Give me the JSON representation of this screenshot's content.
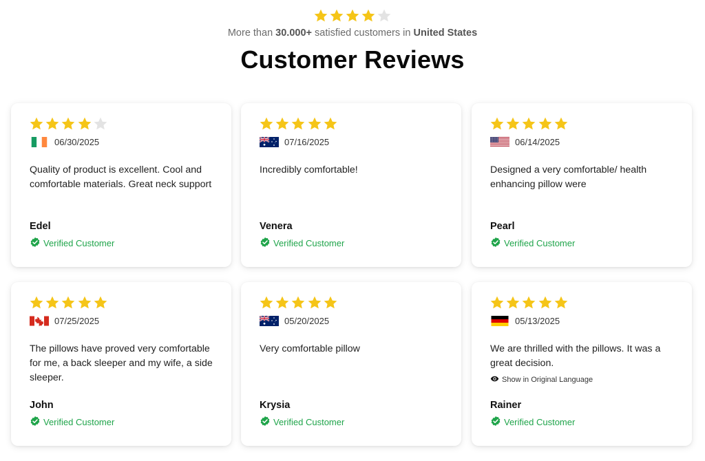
{
  "header": {
    "rating_stars": 4,
    "tagline_prefix": "More than ",
    "tagline_count": "30.000+",
    "tagline_middle": " satisfied customers in ",
    "tagline_country": "United States",
    "title": "Customer Reviews"
  },
  "colors": {
    "star_filled": "#F5C518",
    "star_empty": "#E3E3E3",
    "verified": "#1FA44A"
  },
  "reviews": [
    {
      "stars": 4,
      "flag": "ireland-flag",
      "date": "06/30/2025",
      "text": "Quality of product is excellent. Cool and comfortable materials. Great neck support",
      "name": "Edel",
      "verified": "Verified Customer"
    },
    {
      "stars": 5,
      "flag": "australia-flag",
      "date": "07/16/2025",
      "text": "Incredibly comfortable!",
      "name": "Venera",
      "verified": "Verified Customer"
    },
    {
      "stars": 5,
      "flag": "usa-flag",
      "date": "06/14/2025",
      "text": "Designed a very comfortable/ health enhancing pillow were",
      "name": "Pearl",
      "verified": "Verified Customer"
    },
    {
      "stars": 5,
      "flag": "canada-flag",
      "date": "07/25/2025",
      "text": "The pillows have proved very comfortable for me, a back sleeper and my wife, a side sleeper.",
      "name": "John",
      "verified": "Verified Customer"
    },
    {
      "stars": 5,
      "flag": "australia-flag",
      "date": "05/20/2025",
      "text": "Very comfortable pillow",
      "name": "Krysia",
      "verified": "Verified Customer"
    },
    {
      "stars": 5,
      "flag": "germany-flag",
      "date": "05/13/2025",
      "text": "We are thrilled with the pillows. It was a great decision.",
      "show_original": "Show in Original Language",
      "name": "Rainer",
      "verified": "Verified Customer"
    }
  ]
}
